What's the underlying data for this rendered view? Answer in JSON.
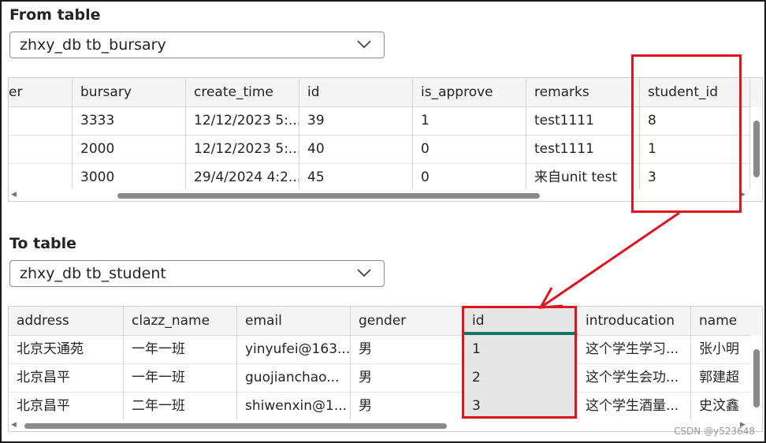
{
  "from": {
    "label": "From table",
    "selected": "zhxy_db tb_bursary",
    "columns": [
      "er",
      "bursary",
      "create_time",
      "id",
      "is_approve",
      "remarks",
      "student_id"
    ],
    "rows": [
      [
        "",
        "3333",
        "12/12/2023 5:...",
        "39",
        "1",
        "test1111",
        "8"
      ],
      [
        "",
        "2000",
        "12/12/2023 5:...",
        "40",
        "0",
        "test1111",
        "1"
      ],
      [
        "",
        "3000",
        "29/4/2024 4:2...",
        "45",
        "0",
        "来自unit test",
        "3"
      ]
    ]
  },
  "to": {
    "label": "To table",
    "selected": "zhxy_db tb_student",
    "columns": [
      "address",
      "clazz_name",
      "email",
      "gender",
      "id",
      "introducation",
      "name"
    ],
    "rows": [
      [
        "北京天通苑",
        "一年一班",
        "yinyufei@163....",
        "男",
        "1",
        "这个学生学习...",
        "张小明"
      ],
      [
        "北京昌平",
        "一年一班",
        "guojianchao...",
        "男",
        "2",
        "这个学生会功...",
        "郭建超"
      ],
      [
        "北京昌平",
        "二年一班",
        "shiwenxin@1...",
        "男",
        "3",
        "这个学生酒量...",
        "史汶鑫"
      ]
    ]
  },
  "icons": {
    "dropdown": "chevron-down-icon"
  },
  "colors": {
    "highlight": "#e0141e",
    "selected_underline": "#117865"
  },
  "watermark": "CSDN @y523648"
}
